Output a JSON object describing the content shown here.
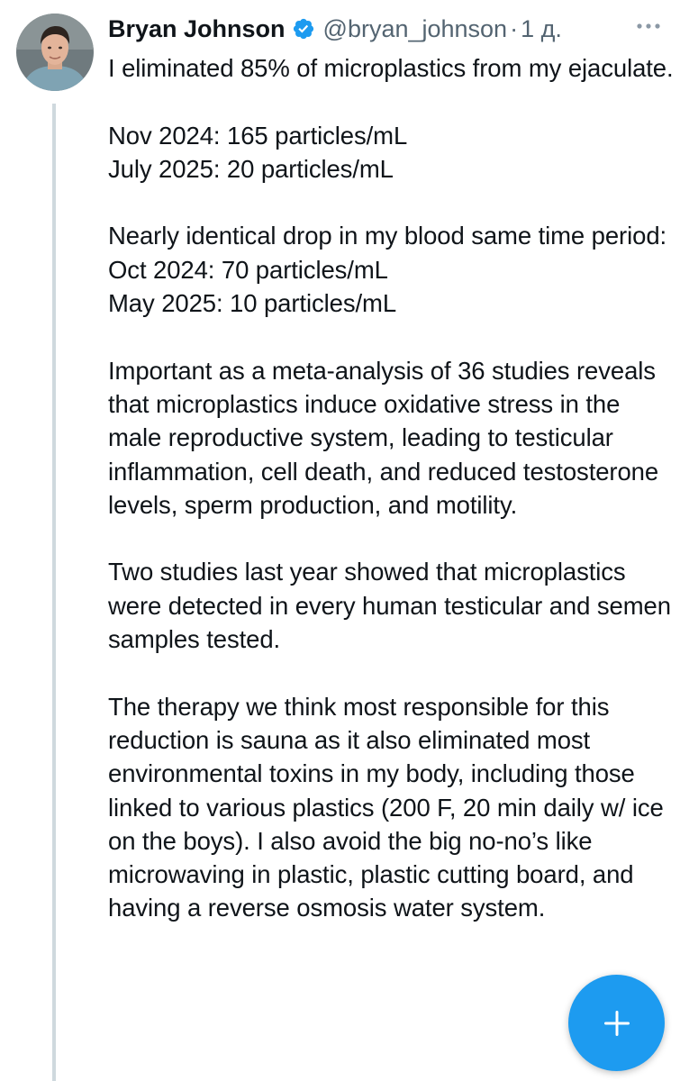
{
  "tweet": {
    "author": {
      "display_name": "Bryan Johnson",
      "handle": "@bryan_johnson",
      "verified": true,
      "avatar": "profile-photo"
    },
    "separator": "·",
    "time": "1 д.",
    "more_icon": "more-horizontal-icon",
    "text": "I eliminated 85% of microplastics from my ejaculate.\n\nNov 2024: 165 particles/mL\nJuly 2025: 20 particles/mL\n\nNearly identical drop in my blood same time period:\nOct 2024: 70 particles/mL\nMay 2025: 10 particles/mL\n\nImportant as a meta-analysis of 36 studies reveals that microplastics induce oxidative stress in the male reproductive system, leading to testicular inflammation, cell death, and reduced testosterone levels, sperm production, and motility.\n\nTwo studies last year showed that microplastics were detected in every human testicular and semen samples tested.\n\nThe therapy we think most responsible for this reduction is sauna as it also eliminated most environmental toxins in my body, including those linked to various plastics (200 F, 20 min daily w/ ice on the boys). I also avoid the big no-no’s like microwaving in plastic, plastic cutting board, and having a reverse osmosis water system."
  },
  "compose_button": {
    "icon": "plus-icon"
  },
  "colors": {
    "accent": "#1d9bf0",
    "text": "#0f1419",
    "secondary_text": "#536471",
    "thread_line": "#cfd9de"
  }
}
